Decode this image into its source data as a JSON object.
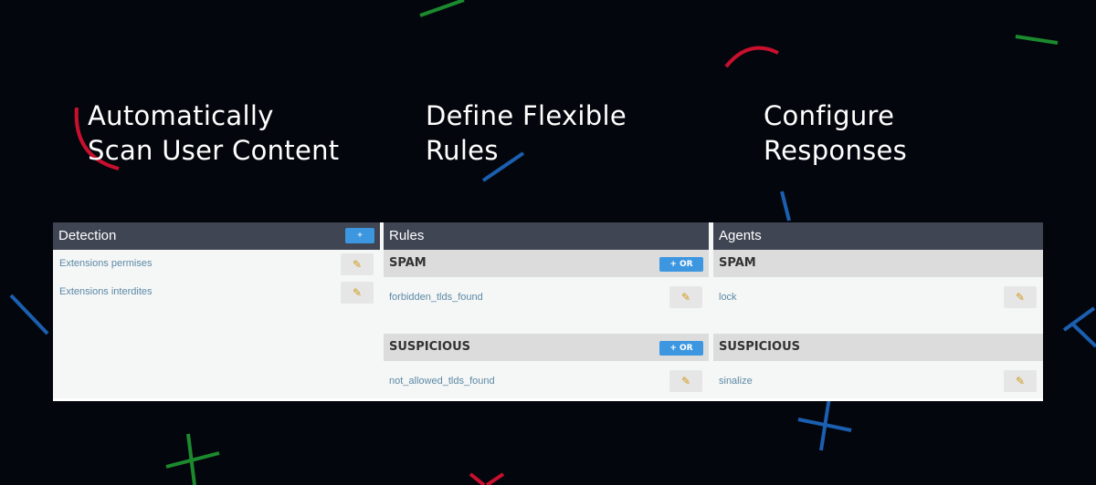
{
  "headlines": {
    "h1": [
      "Automatically",
      "Scan User Content"
    ],
    "h2": [
      "Define Flexible",
      "Rules"
    ],
    "h3": [
      "Configure",
      "Responses"
    ]
  },
  "detection": {
    "title": "Detection",
    "add_label": "+",
    "items": [
      "Extensions permises",
      "Extensions interdites"
    ],
    "edit_glyph": "✎"
  },
  "rules": {
    "title": "Rules",
    "or_label": "+ OR",
    "groups": [
      {
        "name": "SPAM",
        "rule": "forbidden_tlds_found"
      },
      {
        "name": "SUSPICIOUS",
        "rule": "not_allowed_tlds_found"
      }
    ]
  },
  "agents": {
    "title": "Agents",
    "groups": [
      {
        "name": "SPAM",
        "agent": "lock"
      },
      {
        "name": "SUSPICIOUS",
        "agent": "sinalize"
      }
    ]
  },
  "colors": {
    "background": "#04060d",
    "header": "#3f4553",
    "accent_blue": "#3d97e0",
    "deco_red": "#c8102e",
    "deco_green": "#1b8a2e",
    "deco_blue": "#1a5fb0"
  }
}
